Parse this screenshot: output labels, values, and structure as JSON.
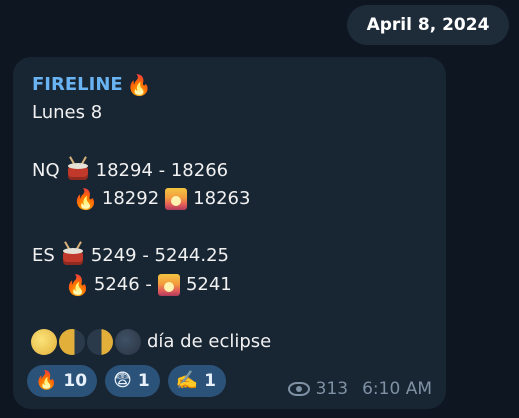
{
  "date_label": "April 8, 2024",
  "message": {
    "sender": "FIRELINE",
    "sender_emoji": "🔥",
    "day": "Lunes 8",
    "nq": {
      "label": "NQ",
      "range": "18294 - 18266",
      "level_fire": "18292",
      "level_sunrise": "18263"
    },
    "es": {
      "label": "ES",
      "range": "5249 - 5244.25",
      "level_fire": "5246 -",
      "level_sunrise": "5241"
    },
    "eclipse_text": "día de eclipse",
    "icons": {
      "drum": "drum-icon",
      "fire": "🔥",
      "sunrise": "sunrise-icon"
    }
  },
  "reactions": [
    {
      "emoji": "🔥",
      "count": "10"
    },
    {
      "emoji": "😨",
      "count": "1"
    },
    {
      "emoji": "✍️",
      "count": "1"
    }
  ],
  "meta": {
    "views": "313",
    "time": "6:10 AM"
  },
  "colors": {
    "background": "#0e1621",
    "bubble": "#182533",
    "sender": "#6ab3f3",
    "reaction": "#2b5278",
    "meta": "#7f91a4"
  }
}
